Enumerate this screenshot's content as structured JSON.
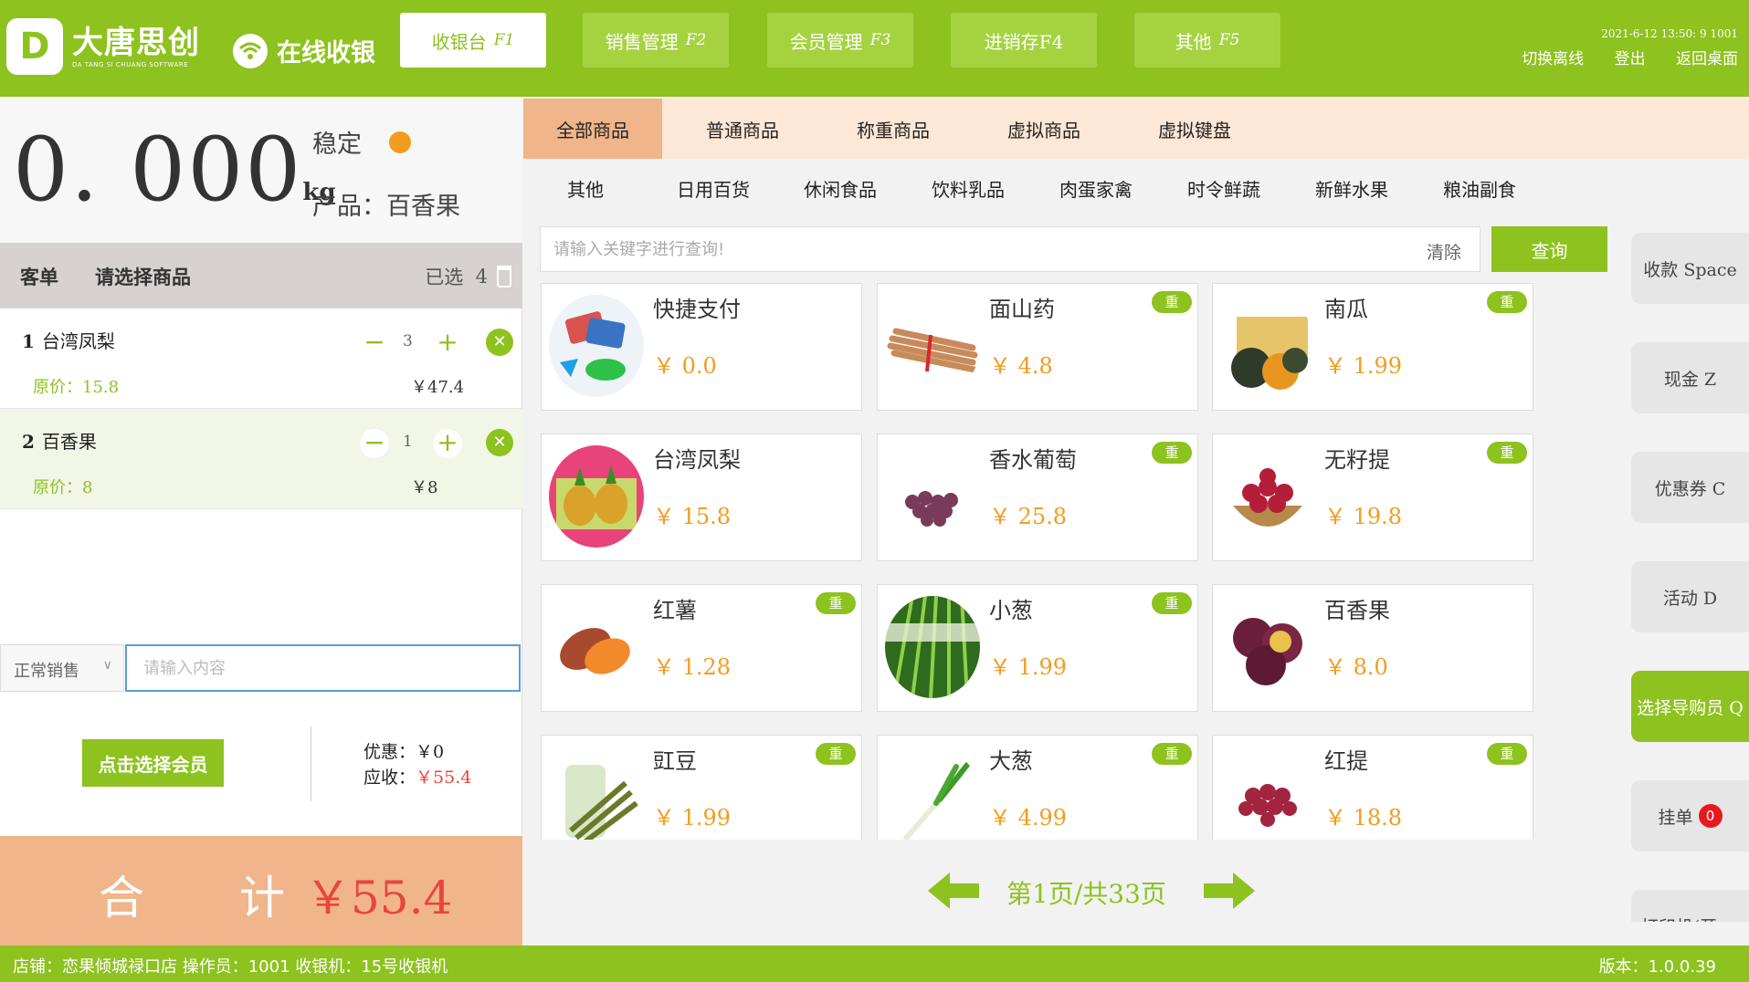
{
  "header": {
    "logo_mark": "D",
    "logo_cn": "大唐思创",
    "logo_en": "DA TANG SI CHUANG SOFTWARE",
    "online_label": "在线收银",
    "nav": [
      {
        "label": "收银台",
        "key": "F1"
      },
      {
        "label": "销售管理",
        "key": "F2"
      },
      {
        "label": "会员管理",
        "key": "F3"
      },
      {
        "label": "进销存F4",
        "key": ""
      },
      {
        "label": "其他",
        "key": "F5"
      }
    ],
    "datetime": "2021-6-12 13:50: 9  1001",
    "links": [
      "切换离线",
      "登出",
      "返回桌面"
    ]
  },
  "scale": {
    "weight": "0. 000",
    "unit": "kg",
    "status": "稳定",
    "status_color": "#f29c1f",
    "product_label": "产品：",
    "product_name": "百香果"
  },
  "order": {
    "tab_label": "客单",
    "hint": "请选择商品",
    "selected_label": "已选",
    "selected_count": "4",
    "items": [
      {
        "index": "1",
        "name": "台湾凤梨",
        "qty": "3",
        "orig_label": "原价：",
        "orig": "15.8",
        "amount": "￥47.4"
      },
      {
        "index": "2",
        "name": "百香果",
        "qty": "1",
        "orig_label": "原价：",
        "orig": "8",
        "amount": "￥8"
      }
    ],
    "mode": "正常销售",
    "input_placeholder": "请输入内容",
    "member_button": "点击选择会员",
    "discount_label": "优惠：",
    "discount_value": "￥0",
    "due_label": "应收：",
    "due_value": "￥55.4",
    "total_label_1": "合",
    "total_label_2": "计",
    "total_value": "￥55.4"
  },
  "categories": {
    "main": [
      "全部商品",
      "普通商品",
      "称重商品",
      "虚拟商品",
      "虚拟键盘"
    ],
    "sub": [
      "其他",
      "日用百货",
      "休闲食品",
      "饮料乳品",
      "肉蛋家禽",
      "时令鲜蔬",
      "新鲜水果",
      "粮油副食"
    ]
  },
  "search": {
    "placeholder": "请输入关键字进行查询!",
    "clear": "清除",
    "query": "查询"
  },
  "products": [
    {
      "name": "快捷支付",
      "price": "￥ 0.0",
      "badge": "",
      "icon": "payment-icon"
    },
    {
      "name": "面山药",
      "price": "￥ 4.8",
      "badge": "重",
      "icon": "yam-icon"
    },
    {
      "name": "南瓜",
      "price": "￥ 1.99",
      "badge": "重",
      "icon": "pumpkin-icon"
    },
    {
      "name": "台湾凤梨",
      "price": "￥ 15.8",
      "badge": "",
      "icon": "pineapple-icon"
    },
    {
      "name": "香水葡萄",
      "price": "￥ 25.8",
      "badge": "重",
      "icon": "grape-icon"
    },
    {
      "name": "无籽提",
      "price": "￥ 19.8",
      "badge": "重",
      "icon": "seedless-grape-icon"
    },
    {
      "name": "红薯",
      "price": "￥ 1.28",
      "badge": "重",
      "icon": "sweet-potato-icon"
    },
    {
      "name": "小葱",
      "price": "￥ 1.99",
      "badge": "重",
      "icon": "scallion-icon"
    },
    {
      "name": "百香果",
      "price": "￥ 8.0",
      "badge": "",
      "icon": "passion-fruit-icon"
    },
    {
      "name": "豇豆",
      "price": "￥ 1.99",
      "badge": "重",
      "icon": "cowpea-icon"
    },
    {
      "name": "大葱",
      "price": "￥ 4.99",
      "badge": "重",
      "icon": "leek-icon"
    },
    {
      "name": "红提",
      "price": "￥ 18.8",
      "badge": "重",
      "icon": "red-grape-icon"
    }
  ],
  "pager": {
    "text": "第1页/共33页"
  },
  "side_buttons": [
    {
      "label": "收款 Space"
    },
    {
      "label": "现金 Z"
    },
    {
      "label": "优惠券 C"
    },
    {
      "label": "活动 D"
    },
    {
      "label": "选择导购员 Q"
    },
    {
      "label": "挂单",
      "badge": "0"
    },
    {
      "label": "打印机(开 ..."
    }
  ],
  "footer": {
    "left": "店铺：恋果倾城禄口店 操作员：1001 收银机：15号收银机",
    "right": "版本：1.0.0.39"
  },
  "colors": {
    "brand": "#8dc21f",
    "accent_orange": "#f29c1f",
    "total_bg": "#f0b58a",
    "red": "#e8453c"
  }
}
